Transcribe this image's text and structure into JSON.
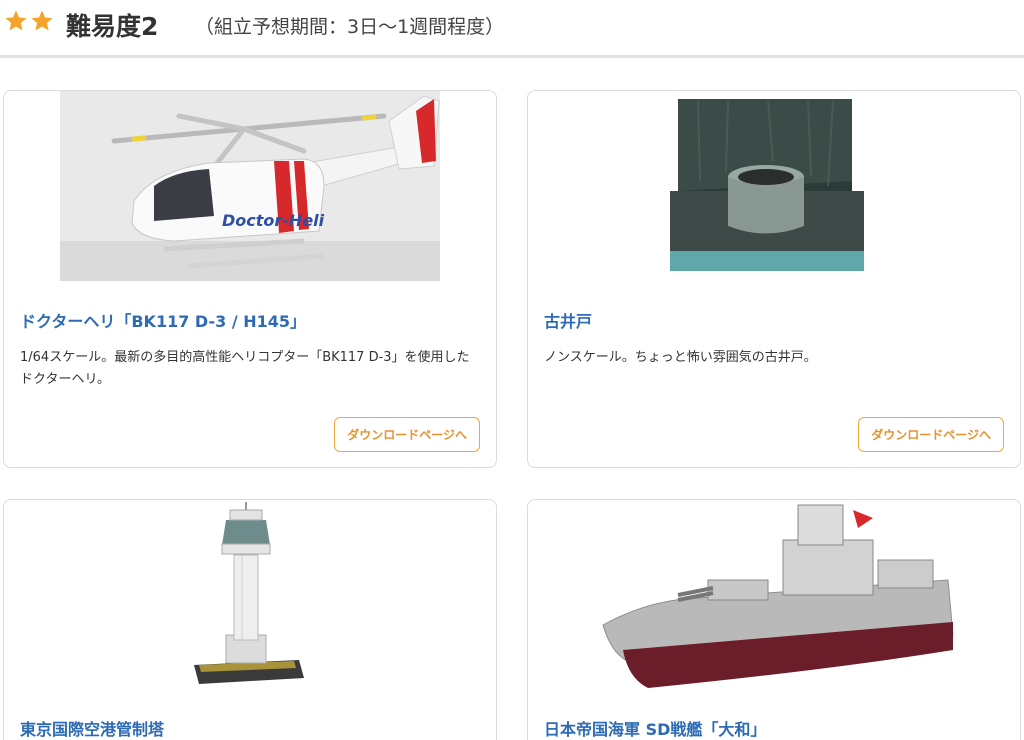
{
  "header": {
    "title": "難易度2",
    "subtitle": "（組立予想期間：3日〜1週間程度）",
    "star_color": "#f4a42b"
  },
  "cards": [
    {
      "title": "ドクターヘリ「BK117 D-3 / H145」",
      "description": "1/64スケール。最新の多目的高性能ヘリコプター「BK117 D-3」を使用したドクターヘリ。",
      "button": "ダウンロードページへ",
      "image_label": "Doctor-Heli"
    },
    {
      "title": "古井戸",
      "description": "ノンスケール。ちょっと怖い雰囲気の古井戸。",
      "button": "ダウンロードページへ"
    },
    {
      "title": "東京国際空港管制塔"
    },
    {
      "title": "日本帝国海軍 SD戦艦「大和」"
    }
  ],
  "colors": {
    "title_blue": "#2e6bb5",
    "button_orange": "#e8922a"
  }
}
